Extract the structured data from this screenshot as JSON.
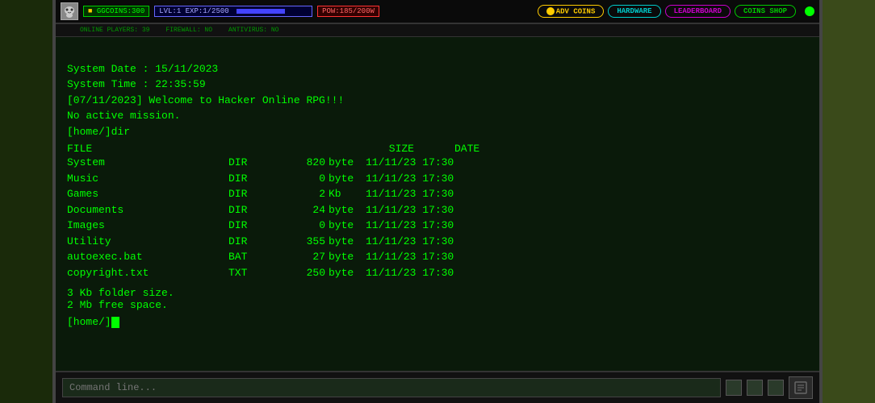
{
  "topbar": {
    "coins_label": "GGCOINS:300",
    "lvl_label": "LVL:1 EXP:1/2500",
    "pow_label": "POW:185/200W",
    "adv_btn": "ADV COINS",
    "hw_btn": "HARDWARE",
    "lb_btn": "LEADERBOARD",
    "cs_btn": "COINS SHOP"
  },
  "subbar": {
    "online": "ONLINE PLAYERS: 39",
    "firewall": "FIREWALL: NO",
    "antivirus": "ANTIVIRUS: NO"
  },
  "terminal": {
    "line1": "System Date : 15/11/2023",
    "line2": "System Time : 22:35:59",
    "line3": "[07/11/2023] Welcome to Hacker Online RPG!!!",
    "line4": "No active mission.",
    "line5": "[home/]dir",
    "header_file": "FILE",
    "header_size": "SIZE",
    "header_date": "DATE",
    "files": [
      {
        "name": "System",
        "type": "DIR",
        "size": "820",
        "unit": "byte",
        "date": "11/11/23 17:30"
      },
      {
        "name": "Music",
        "type": "DIR",
        "size": "0",
        "unit": "byte",
        "date": "11/11/23 17:30"
      },
      {
        "name": "Games",
        "type": "DIR",
        "size": "2",
        "unit": "Kb",
        "date": "11/11/23 17:30"
      },
      {
        "name": "Documents",
        "type": "DIR",
        "size": "24",
        "unit": "byte",
        "date": "11/11/23 17:30"
      },
      {
        "name": "Images",
        "type": "DIR",
        "size": "0",
        "unit": "byte",
        "date": "11/11/23 17:30"
      },
      {
        "name": "Utility",
        "type": "DIR",
        "size": "355",
        "unit": "byte",
        "date": "11/11/23 17:30"
      },
      {
        "name": "autoexec.bat",
        "type": "BAT",
        "size": "27",
        "unit": "byte",
        "date": "11/11/23 17:30"
      },
      {
        "name": "copyright.txt",
        "type": "TXT",
        "size": "250",
        "unit": "byte",
        "date": "11/11/23 17:30"
      }
    ],
    "footer1": "3 Kb folder size.",
    "footer2": "2 Mb free space.",
    "prompt": "[home/]"
  },
  "command": {
    "placeholder": "Command line..."
  }
}
